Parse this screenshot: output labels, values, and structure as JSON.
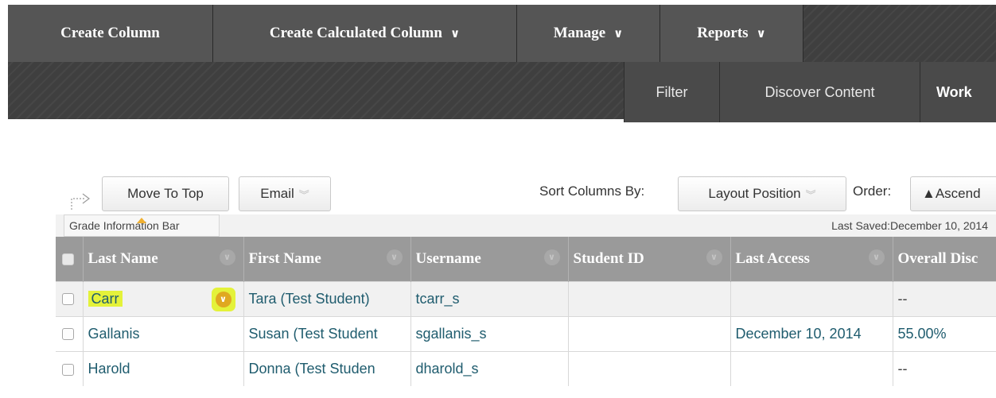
{
  "nav": {
    "primary": [
      {
        "label": "Create Column",
        "chevron": ""
      },
      {
        "label": "Create Calculated Column",
        "chevron": "∨"
      },
      {
        "label": "Manage",
        "chevron": "∨"
      },
      {
        "label": "Reports",
        "chevron": "∨"
      }
    ],
    "secondary": [
      "Filter",
      "Discover Content",
      "Work"
    ]
  },
  "toolbar": {
    "move_to_top": "Move To Top",
    "email": "Email",
    "sort_label": "Sort Columns By:",
    "sort_value": "Layout Position",
    "order_label": "Order:",
    "order_value": "▲Ascend"
  },
  "info_bar": {
    "tab": "Grade Information Bar",
    "last_saved": "Last Saved:December 10, 2014"
  },
  "grid": {
    "columns": [
      "Last Name",
      "First Name",
      "Username",
      "Student ID",
      "Last Access",
      "Overall Disc"
    ],
    "rows": [
      {
        "last": "Carr",
        "first": "Tara (Test Student)",
        "username": "tcarr_s",
        "student_id": "",
        "last_access": "",
        "overall": "--"
      },
      {
        "last": "Gallanis",
        "first": "Susan (Test Student",
        "username": "sgallanis_s",
        "student_id": "",
        "last_access": "December 10, 2014",
        "overall": "55.00%"
      },
      {
        "last": "Harold",
        "first": "Donna (Test Studen",
        "username": "dharold_s",
        "student_id": "",
        "last_access": "",
        "overall": "--"
      }
    ]
  },
  "colors": {
    "highlight": "#e4f23a",
    "header_bg": "#9a9a9a",
    "nav_bg": "#3f3f3f",
    "link": "#1f5c6e"
  }
}
